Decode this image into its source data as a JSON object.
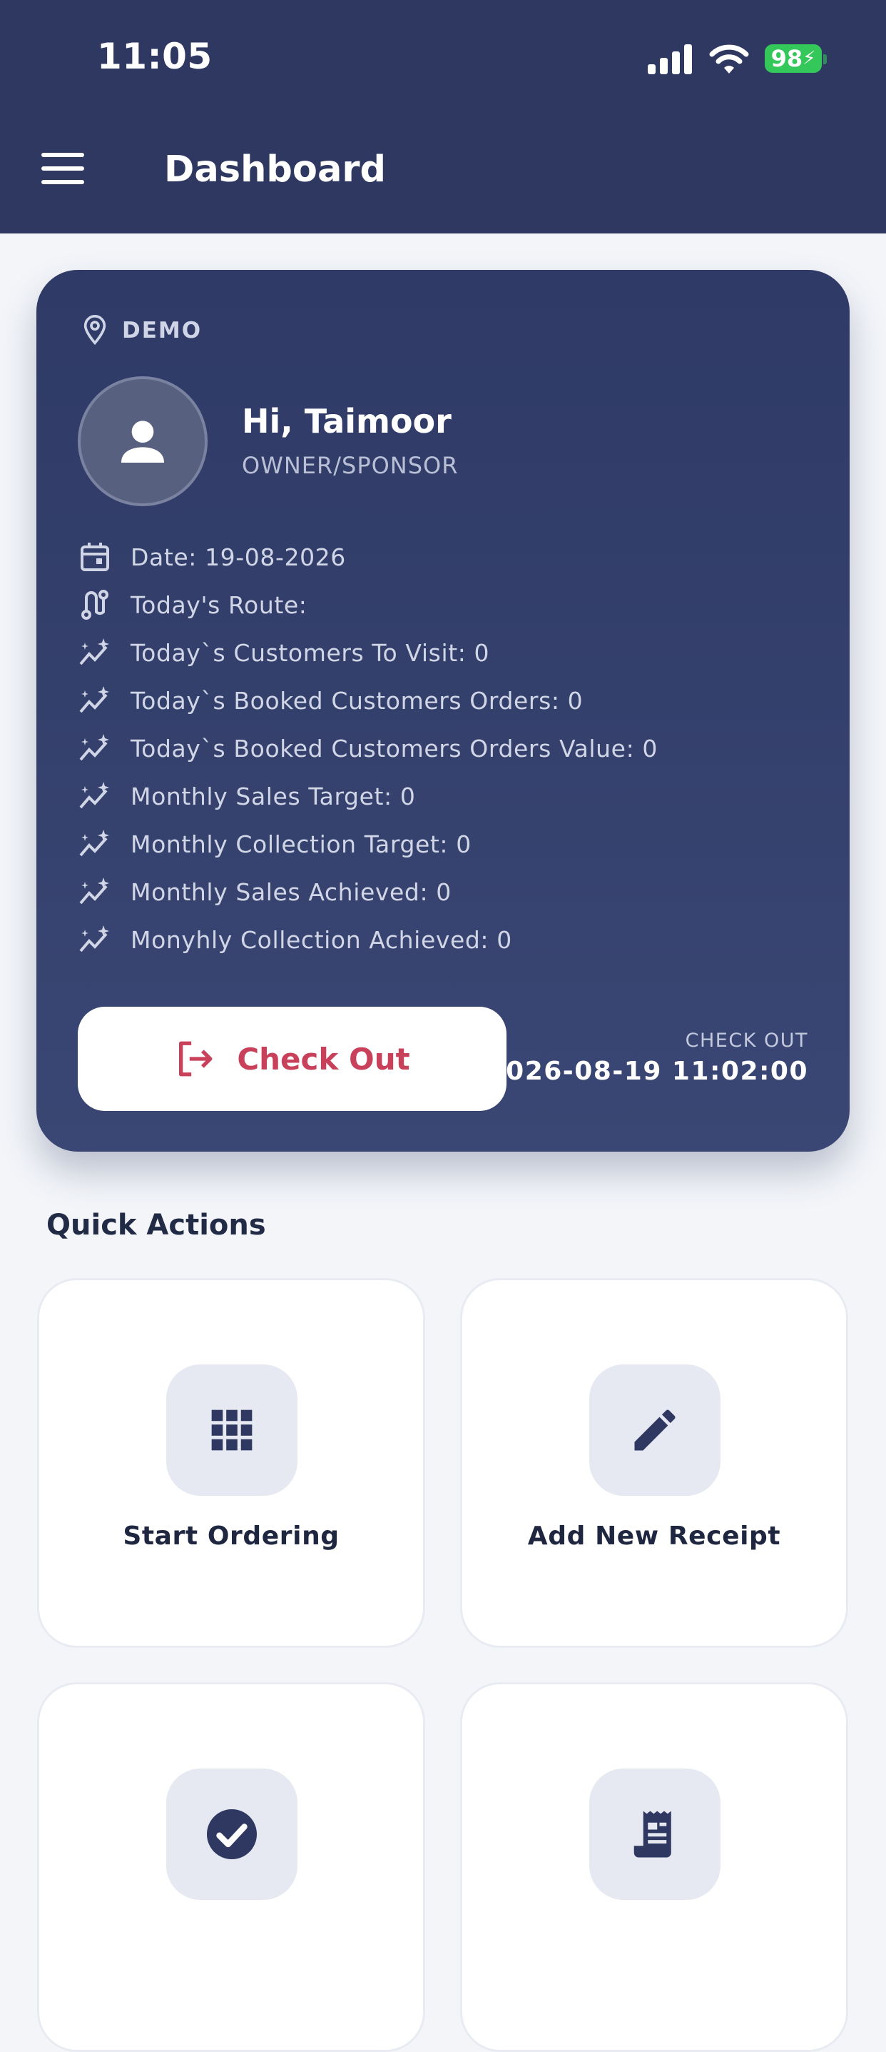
{
  "status_bar": {
    "time": "11:05",
    "battery": "98",
    "icons": [
      "signal-icon",
      "wifi-icon",
      "battery-charging-icon"
    ]
  },
  "header": {
    "title": "Dashboard",
    "menu_icon": "hamburger-menu-icon"
  },
  "profile_card": {
    "location": "DEMO",
    "greeting": "Hi, Taimoor",
    "role": "OWNER/SPONSOR",
    "info": [
      {
        "icon": "calendar-icon",
        "text": "Date: 19-08-2026"
      },
      {
        "icon": "route-icon",
        "text": "Today's Route:"
      },
      {
        "icon": "sparkle-trend-icon",
        "text": "Today`s Customers To Visit: 0"
      },
      {
        "icon": "sparkle-trend-icon",
        "text": "Today`s Booked Customers Orders: 0"
      },
      {
        "icon": "sparkle-trend-icon",
        "text": "Today`s Booked Customers Orders Value: 0"
      },
      {
        "icon": "sparkle-trend-icon",
        "text": "Monthly Sales Target: 0"
      },
      {
        "icon": "sparkle-trend-icon",
        "text": "Monthly Collection Target: 0"
      },
      {
        "icon": "sparkle-trend-icon",
        "text": "Monthly Sales Achieved: 0"
      },
      {
        "icon": "sparkle-trend-icon",
        "text": "Monyhly Collection Achieved: 0"
      }
    ],
    "checkout_button": "Check Out",
    "checkout_caption": "CHECK OUT",
    "checkout_time": "2026-08-19 11:02:00"
  },
  "quick_actions": {
    "title": "Quick Actions",
    "tiles": [
      {
        "label": "Start Ordering",
        "icon": "grid-apps-icon"
      },
      {
        "label": "Add New Receipt",
        "icon": "pencil-icon"
      },
      {
        "label": "",
        "icon": "check-circle-icon"
      },
      {
        "label": "",
        "icon": "receipt-icon"
      }
    ]
  },
  "colors": {
    "header_bg": "#2e3861",
    "card_bg": "#34406b",
    "accent_red": "#c8405a",
    "page_bg": "#f3f5f9"
  }
}
